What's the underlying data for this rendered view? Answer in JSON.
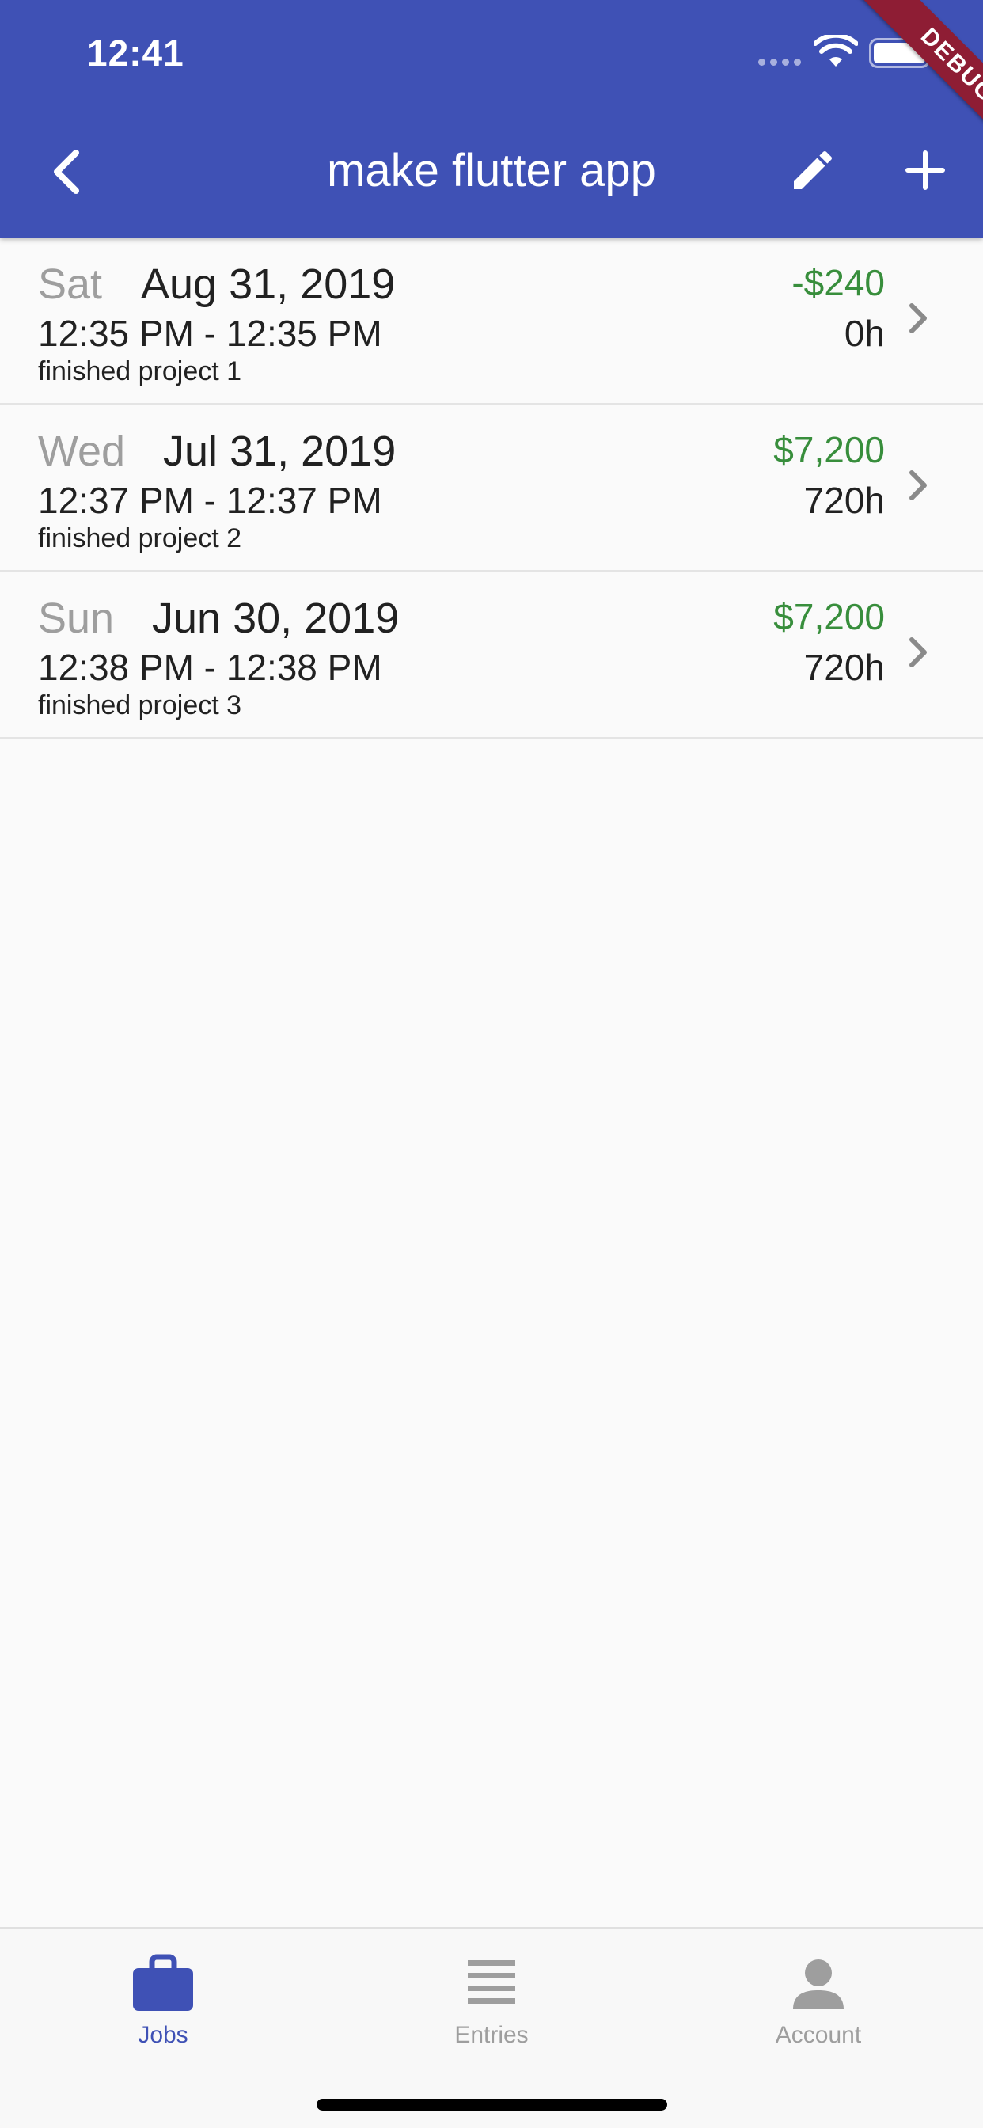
{
  "status_bar": {
    "time": "12:41"
  },
  "debug_banner": "DEBUG",
  "app_bar": {
    "title": "make flutter app",
    "background_color": "#3f51b5",
    "back_icon": "chevron-left-icon",
    "edit_icon": "pencil-icon",
    "add_icon": "plus-icon"
  },
  "entries": [
    {
      "weekday": "Sat",
      "date": "Aug 31, 2019",
      "time_range": "12:35 PM - 12:35 PM",
      "description": "finished project 1",
      "pay": "-$240",
      "duration": "0h"
    },
    {
      "weekday": "Wed",
      "date": "Jul 31, 2019",
      "time_range": "12:37 PM - 12:37 PM",
      "description": "finished project 2",
      "pay": "$7,200",
      "duration": "720h"
    },
    {
      "weekday": "Sun",
      "date": "Jun 30, 2019",
      "time_range": "12:38 PM - 12:38 PM",
      "description": "finished project 3",
      "pay": "$7,200",
      "duration": "720h"
    }
  ],
  "colors": {
    "pay_text": "#388e3c",
    "weekday_text": "#9e9e9e",
    "active_tab": "#3f51b5",
    "inactive_tab": "#9e9e9e"
  },
  "bottom_nav": {
    "items": [
      {
        "label": "Jobs",
        "icon": "briefcase-icon",
        "active": true
      },
      {
        "label": "Entries",
        "icon": "list-icon",
        "active": false
      },
      {
        "label": "Account",
        "icon": "person-icon",
        "active": false
      }
    ]
  }
}
